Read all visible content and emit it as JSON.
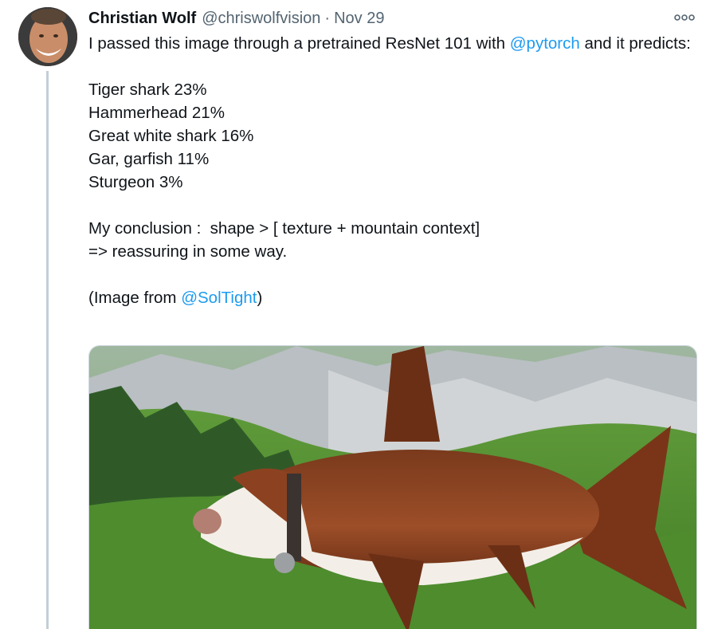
{
  "tweet": {
    "author_name": "Christian Wolf",
    "handle": "@chriswolfvision",
    "separator": "·",
    "date": "Nov 29",
    "more_icon": "more-horizontal-icon",
    "text": {
      "line1_before": "I passed this image through a pretrained ResNet 101 with ",
      "line1_mention": "@pytorch",
      "line1_after": " and it predicts:",
      "predictions": [
        "Tiger shark 23%",
        "Hammerhead 21%",
        "Great white shark 16%",
        "Gar, garfish 11%",
        "Sturgeon 3%"
      ],
      "conclusion_1": "My conclusion :  shape > [ texture + mountain context]",
      "conclusion_2": "=> reassuring in some way.",
      "credit_before": "(Image from ",
      "credit_mention": "@SolTight",
      "credit_after": ")"
    },
    "media": {
      "description_icon": "cow-shark-photo"
    }
  }
}
